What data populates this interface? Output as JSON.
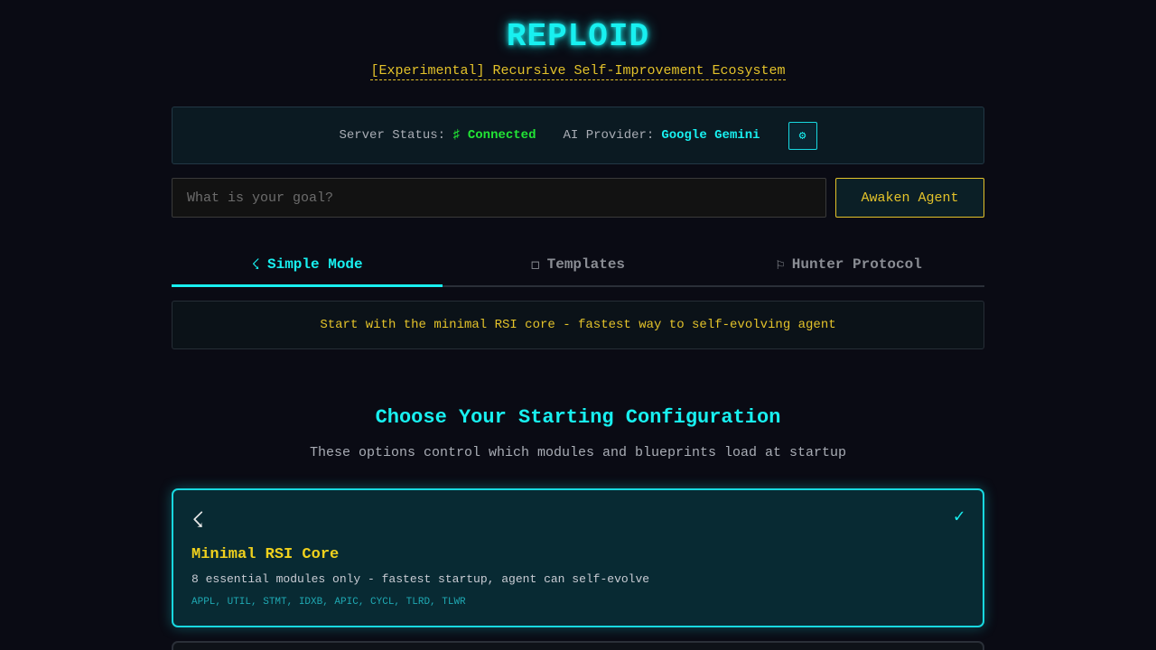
{
  "header": {
    "title": "REPLOID",
    "subtitle": "[Experimental] Recursive Self-Improvement Ecosystem"
  },
  "status": {
    "server_label": "Server Status:",
    "server_icon": "♯",
    "server_value": "Connected",
    "provider_label": "AI Provider:",
    "provider_value": "Google Gemini",
    "settings_icon": "⚙"
  },
  "goal": {
    "placeholder": "What is your goal?",
    "value": "",
    "button_label": "Awaken Agent"
  },
  "tabs": [
    {
      "icon": "☇",
      "label": "Simple Mode",
      "active": true
    },
    {
      "icon": "◻",
      "label": "Templates",
      "active": false
    },
    {
      "icon": "⚐",
      "label": "Hunter Protocol",
      "active": false
    }
  ],
  "mode_description": "Start with the minimal RSI core - fastest way to self-evolving agent",
  "config": {
    "title": "Choose Your Starting Configuration",
    "subtitle": "These options control which modules and blueprints load at startup",
    "options": [
      {
        "icon": "☇",
        "title": "Minimal RSI Core",
        "description": "8 essential modules only - fastest startup, agent can self-evolve",
        "modules": "APPL, UTIL, STMT, IDXB, APIC, CYCL, TLRD, TLWR",
        "selected": true,
        "check_icon": "✓"
      }
    ]
  },
  "colors": {
    "accent_cyan": "#18f0f0",
    "accent_yellow": "#e3c22a",
    "status_green": "#22e535",
    "background": "#0a0b14"
  }
}
